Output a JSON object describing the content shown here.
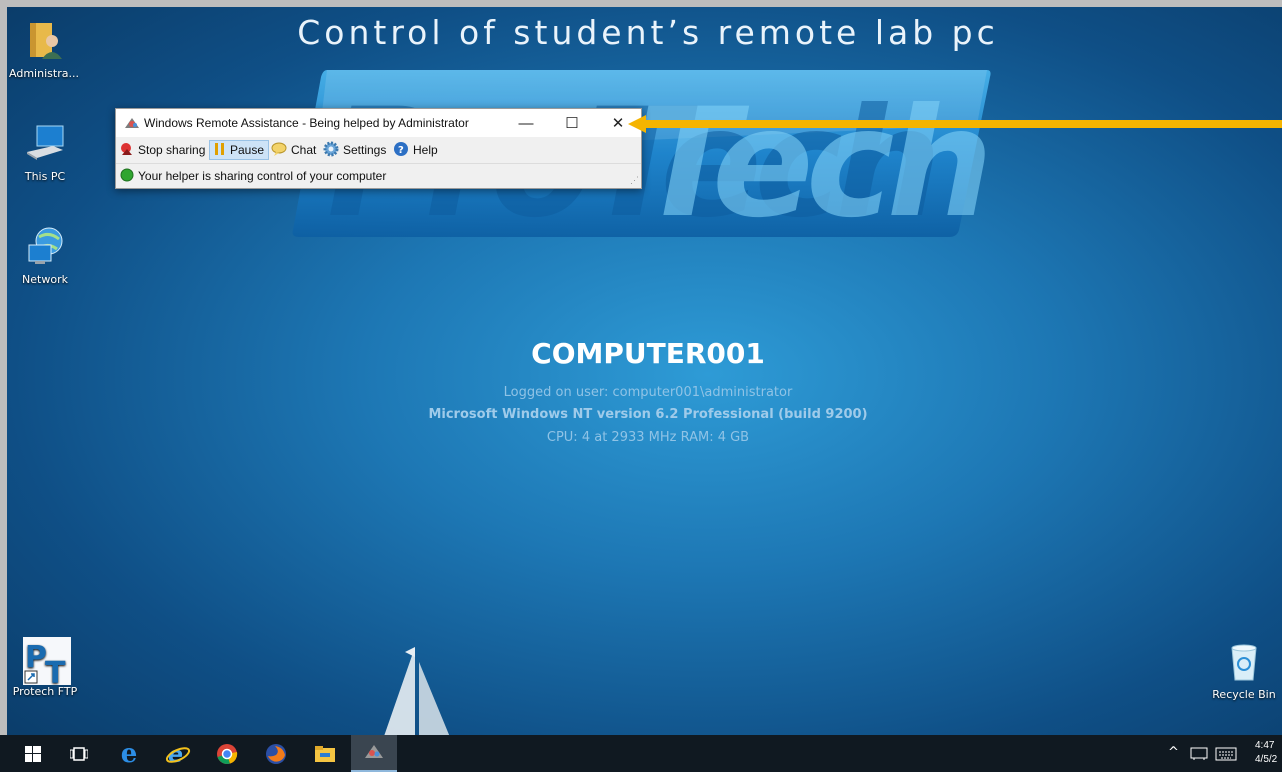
{
  "banner": {
    "caption": "Control of student’s remote lab pc"
  },
  "desktop_icons": [
    {
      "label": "Administra..."
    },
    {
      "label": "This PC"
    },
    {
      "label": "Network"
    },
    {
      "label": "Protech FTP"
    },
    {
      "label": "Recycle Bin"
    }
  ],
  "logo": {
    "text": "ProTech",
    "colors": {
      "primary": "#1a6bb0",
      "accent": "#2fa3e0"
    }
  },
  "remote_assistance": {
    "title": "Windows Remote Assistance - Being helped by Administrator",
    "window_controls": {
      "minimize": "—",
      "maximize": "☐",
      "close": "✕"
    },
    "toolbar": {
      "stop_sharing": "Stop sharing",
      "pause": "Pause",
      "chat": "Chat",
      "settings": "Settings",
      "help": "Help"
    },
    "status": "Your helper is sharing control of your computer"
  },
  "system_info": {
    "hostname": "COMPUTER001",
    "logged_on": "Logged on user: computer001\\administrator",
    "os": "Microsoft Windows NT version 6.2 Professional  (build 9200)",
    "hardware": "CPU: 4 at 2933 MHz    RAM: 4   GB"
  },
  "taskbar": {
    "icons": [
      "windows-start-icon",
      "task-view-icon",
      "edge-icon",
      "internet-explorer-icon",
      "chrome-icon",
      "firefox-icon",
      "file-explorer-icon",
      "remote-assistance-icon"
    ],
    "clock_time": "4:47",
    "clock_date": "4/5/2"
  },
  "colors": {
    "arrow": "#f5b400",
    "status_ok": "#2fa52f",
    "taskbar": "#101921"
  }
}
